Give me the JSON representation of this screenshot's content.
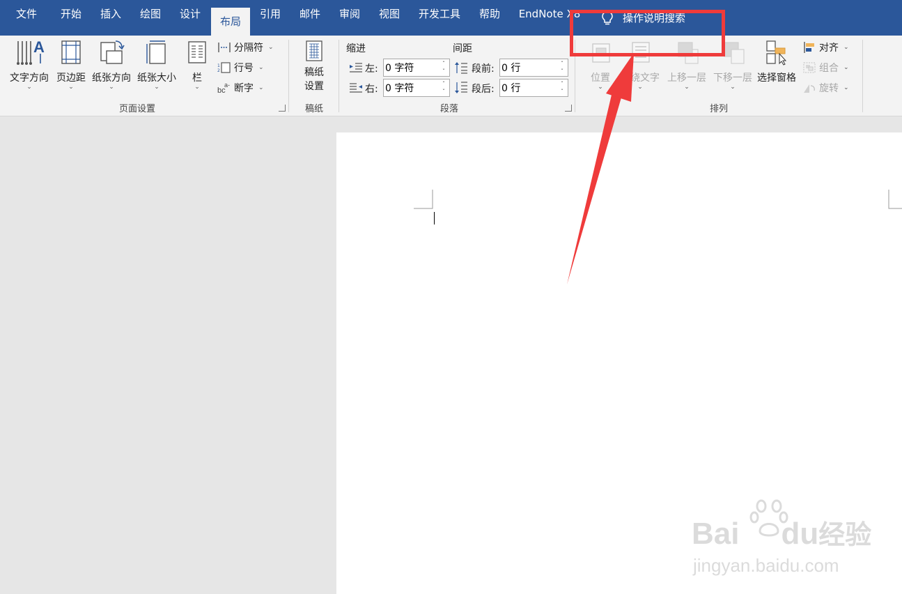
{
  "menubar": {
    "tabs": [
      {
        "label": "文件"
      },
      {
        "label": "开始"
      },
      {
        "label": "插入"
      },
      {
        "label": "绘图"
      },
      {
        "label": "设计"
      },
      {
        "label": "布局",
        "active": true
      },
      {
        "label": "引用"
      },
      {
        "label": "邮件"
      },
      {
        "label": "审阅"
      },
      {
        "label": "视图"
      },
      {
        "label": "开发工具"
      },
      {
        "label": "帮助"
      },
      {
        "label": "EndNote X8"
      }
    ],
    "search_label": "操作说明搜索",
    "bg": "#2b579a"
  },
  "page_setup": {
    "text_direction": "文字方向",
    "margins": "页边距",
    "orientation": "纸张方向",
    "size": "纸张大小",
    "columns": "栏",
    "breaks": "分隔符",
    "line_numbers": "行号",
    "hyphenation": "断字",
    "group_label": "页面设置"
  },
  "draft": {
    "line1": "稿纸",
    "line2": "设置",
    "group_label": "稿纸"
  },
  "paragraph": {
    "indent_header": "缩进",
    "spacing_header": "间距",
    "left_label": "左:",
    "left_value": "0 字符",
    "right_label": "右:",
    "right_value": "0 字符",
    "before_label": "段前:",
    "before_value": "0 行",
    "after_label": "段后:",
    "after_value": "0 行",
    "group_label": "段落"
  },
  "arrange": {
    "position": "位置",
    "wrap_text": "环绕文字",
    "bring_forward": "上移一层",
    "send_backward": "下移一层",
    "selection_pane": "选择窗格",
    "align": "对齐",
    "group": "组合",
    "rotate": "旋转",
    "group_label": "排列"
  },
  "annotation": {
    "color": "#ef3b3b"
  },
  "watermark": {
    "brand_a": "Bai",
    "brand_b": "du",
    "brand_c": "经验",
    "url": "jingyan.baidu.com"
  }
}
